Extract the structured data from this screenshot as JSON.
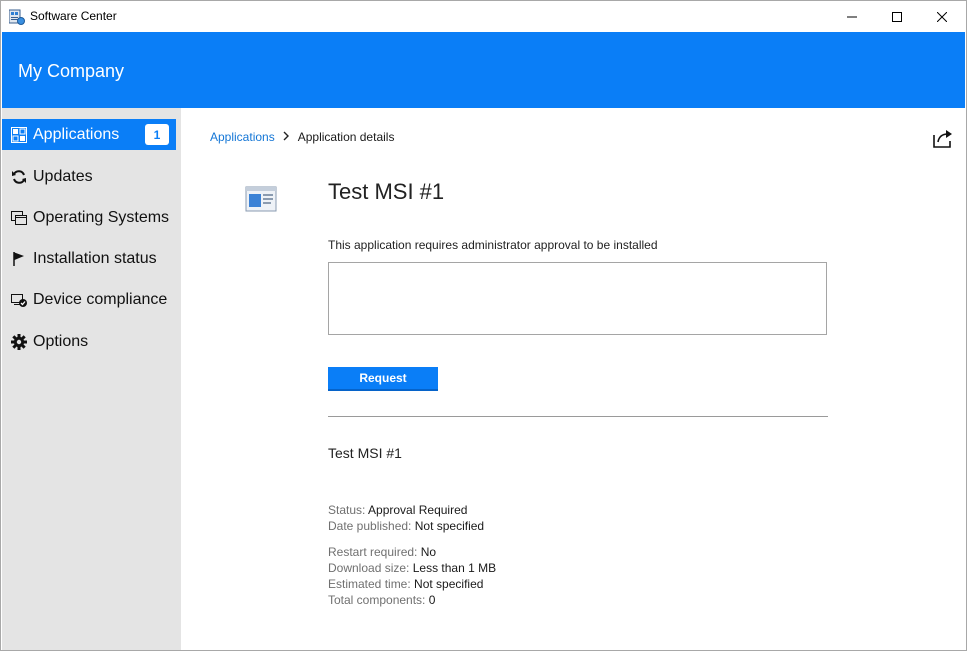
{
  "window": {
    "title": "Software Center",
    "controls": {
      "minimize": "minimize",
      "maximize": "maximize",
      "close": "close"
    }
  },
  "header": {
    "company": "My Company",
    "color": "#0a7ef7"
  },
  "sidebar": {
    "items": [
      {
        "label": "Applications",
        "icon": "applications-grid-icon",
        "badge": "1",
        "active": true
      },
      {
        "label": "Updates",
        "icon": "refresh-icon"
      },
      {
        "label": "Operating Systems",
        "icon": "windows-icon"
      },
      {
        "label": "Installation status",
        "icon": "flag-icon"
      },
      {
        "label": "Device compliance",
        "icon": "device-check-icon"
      },
      {
        "label": "Options",
        "icon": "gear-icon"
      }
    ]
  },
  "breadcrumb": {
    "link": "Applications",
    "current": "Application details"
  },
  "app": {
    "title": "Test MSI #1",
    "approval_text": "This application requires administrator approval to be installed",
    "reason_value": "",
    "request_label": "Request",
    "subtitle": "Test MSI #1"
  },
  "details": {
    "status": {
      "label": "Status:",
      "value": "Approval Required"
    },
    "date_published": {
      "label": "Date published:",
      "value": "Not specified"
    },
    "restart_required": {
      "label": "Restart required:",
      "value": "No"
    },
    "download_size": {
      "label": "Download size:",
      "value": "Less than 1 MB"
    },
    "estimated_time": {
      "label": "Estimated time:",
      "value": "Not specified"
    },
    "total_components": {
      "label": "Total components:",
      "value": "0"
    }
  }
}
